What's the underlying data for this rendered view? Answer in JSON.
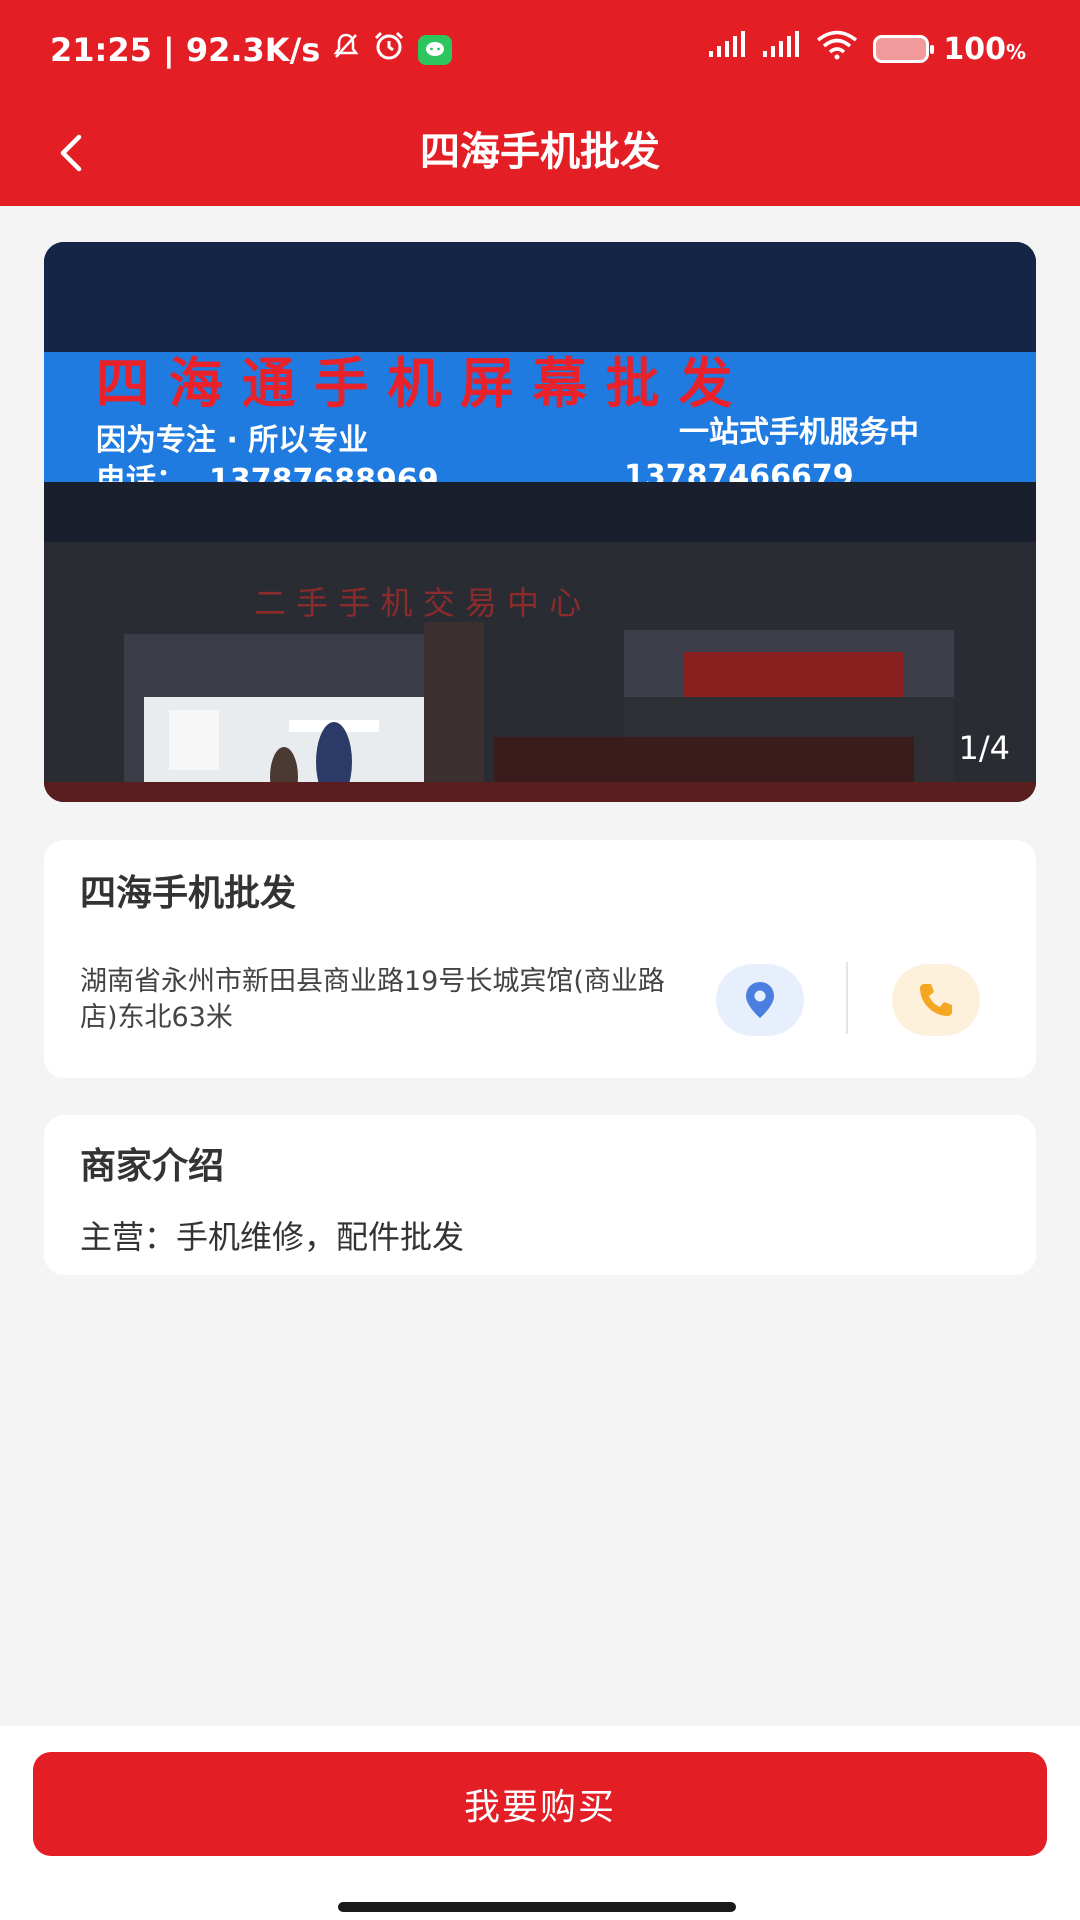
{
  "status_bar": {
    "time_speed": "21:25 | 92.3K/s",
    "battery_percent": "100",
    "battery_unit": "%",
    "icons": [
      "mute-icon",
      "alarm-icon",
      "wechat-icon",
      "signal-icon",
      "signal-icon",
      "wifi-icon",
      "battery-icon"
    ]
  },
  "nav": {
    "title": "四海手机批发",
    "back_icon": "chevron-left-icon"
  },
  "gallery": {
    "counter": "1/4",
    "sign_line1": "四 海 通 手 机 屏 幕 批 发",
    "sign_line2_left": "因为专注 · 所以专业",
    "sign_line2_right": "一站式手机服务中",
    "sign_line3_label": "电话：",
    "sign_phone1": "13787688969",
    "sign_phone2": "13787466679",
    "lower_sign": "二  手  手  机  交  易  中  心",
    "colors": {
      "sign_bg": "#1f7be0",
      "sign_text_red": "#e8212a"
    }
  },
  "shop": {
    "name": "四海手机批发",
    "address": "湖南省永州市新田县商业路19号长城宾馆(商业路店)东北63米",
    "location_icon": "location-pin-icon",
    "phone_icon": "phone-icon"
  },
  "intro": {
    "title": "商家介绍",
    "text": "主营：手机维修，配件批发"
  },
  "footer": {
    "buy_label": "我要购买"
  },
  "colors": {
    "primary": "#e31e25",
    "background": "#f4f4f4",
    "location_accent": "#4a7fe0",
    "phone_accent": "#f5a623"
  }
}
